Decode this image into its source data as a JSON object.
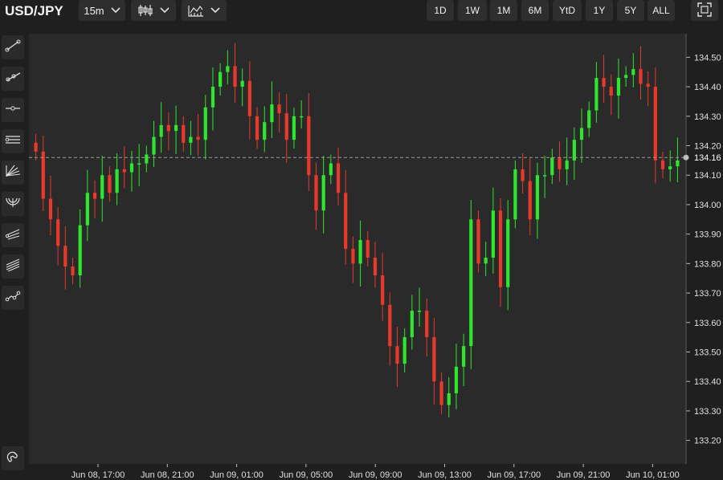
{
  "header": {
    "symbol": "USD/JPY",
    "interval": "15m",
    "ranges": [
      "1D",
      "1W",
      "1M",
      "6M",
      "YtD",
      "1Y",
      "5Y",
      "ALL"
    ]
  },
  "icons": {
    "interval_chevron": "chevron-down-icon",
    "chart_type": "candlestick-icon",
    "indicators": "indicators-icon",
    "fullscreen": "fullscreen-icon",
    "tools": [
      "trend-line-icon",
      "ray-icon",
      "horizontal-line-icon",
      "parallel-channel-icon",
      "fan-icon",
      "arc-icon",
      "pitchfork-icon",
      "multi-line-icon",
      "path-icon",
      "magnet-icon"
    ]
  },
  "colors": {
    "up": "#2ee62e",
    "down": "#e8392b",
    "background": "#2a2a2a",
    "axis_text": "#e0e0e0"
  },
  "chart_data": {
    "type": "candlestick",
    "title": "USD/JPY",
    "interval": "15m",
    "ylim": [
      133.12,
      134.58
    ],
    "y_ticks": [
      133.2,
      133.3,
      133.4,
      133.5,
      133.6,
      133.7,
      133.8,
      133.9,
      134.0,
      134.1,
      134.2,
      134.3,
      134.4,
      134.5
    ],
    "y_tick_labels": [
      "133.20",
      "133.30",
      "133.40",
      "133.50",
      "133.60",
      "133.70",
      "133.80",
      "133.90",
      "134.00",
      "134.10",
      "134.20",
      "134.30",
      "134.40",
      "134.50"
    ],
    "x_tick_labels": [
      "Jun 08, 17:00",
      "Jun 08, 21:00",
      "Jun 09, 01:00",
      "Jun 09, 05:00",
      "Jun 09, 09:00",
      "Jun 09, 13:00",
      "Jun 09, 17:00",
      "Jun 09, 21:00",
      "Jun 10, 01:00"
    ],
    "current_price": 134.16,
    "current_price_label": "134.16",
    "closes": [
      134.18,
      134.02,
      133.95,
      133.86,
      133.79,
      133.76,
      133.93,
      134.04,
      134.02,
      134.1,
      134.04,
      134.12,
      134.11,
      134.14,
      134.14,
      134.17,
      134.23,
      134.27,
      134.25,
      134.27,
      134.21,
      134.23,
      134.22,
      134.33,
      134.4,
      134.45,
      134.47,
      134.4,
      134.42,
      134.3,
      134.22,
      134.28,
      134.34,
      134.31,
      134.22,
      134.3,
      134.3,
      134.1,
      133.98,
      134.1,
      134.14,
      134.04,
      133.85,
      133.8,
      133.88,
      133.82,
      133.76,
      133.66,
      133.52,
      133.46,
      133.55,
      133.64,
      133.64,
      133.55,
      133.4,
      133.32,
      133.36,
      133.45,
      133.52,
      133.95,
      133.8,
      133.82,
      133.98,
      133.72,
      133.95,
      134.12,
      134.08,
      133.95,
      134.1,
      134.1,
      134.16,
      134.12,
      134.15,
      134.22,
      134.26,
      134.32,
      134.43,
      134.4,
      134.37,
      134.43,
      134.44,
      134.46,
      134.41,
      134.4,
      134.15,
      134.12,
      134.13,
      134.15
    ]
  }
}
